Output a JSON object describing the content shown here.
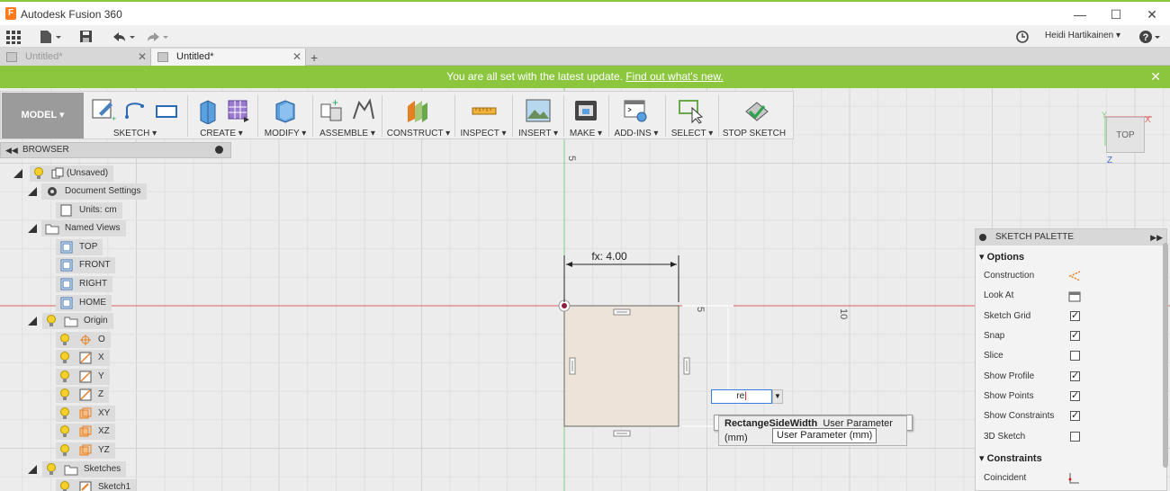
{
  "window": {
    "title": "Autodesk Fusion 360"
  },
  "user": {
    "name": "Heidi Hartikainen ▾"
  },
  "tabs": [
    {
      "label": "Untitled*"
    },
    {
      "label": "Untitled*"
    }
  ],
  "banner": {
    "text": "You are all set with the latest update.",
    "link": "Find out what's new."
  },
  "ribbon": {
    "workspace": "MODEL ▾",
    "groups": [
      "SKETCH ▾",
      "CREATE ▾",
      "MODIFY ▾",
      "ASSEMBLE ▾",
      "CONSTRUCT ▾",
      "INSPECT ▾",
      "INSERT ▾",
      "MAKE ▾",
      "ADD-INS ▾",
      "SELECT ▾",
      "STOP SKETCH"
    ]
  },
  "browser": {
    "title": "BROWSER",
    "nodes": {
      "root": "(Unsaved)",
      "doc_settings": "Document Settings",
      "units": "Units: cm",
      "named_views": "Named Views",
      "top": "TOP",
      "front": "FRONT",
      "right": "RIGHT",
      "home": "HOME",
      "origin": "Origin",
      "o": "O",
      "x": "X",
      "y": "Y",
      "z": "Z",
      "xy": "XY",
      "xz": "XZ",
      "yz": "YZ",
      "sketches": "Sketches",
      "sketch1": "Sketch1"
    }
  },
  "viewcube": {
    "face": "TOP",
    "x_axis": "X",
    "y_axis": "Y",
    "z_axis": "Z"
  },
  "canvas": {
    "dimension_label": "fx: 4.00",
    "tick_top": "5",
    "tick_right_near": "5",
    "tick_right_far": "10",
    "input_value": "re",
    "suggestion_name": "RectangeSideWidth",
    "suggestion_type": "User Parameter (mm)",
    "tooltip": "User Parameter (mm)"
  },
  "palette": {
    "title": "SKETCH PALETTE",
    "options_header": "Options",
    "constraints_header": "Constraints",
    "options": [
      {
        "label": "Construction",
        "control": "construction-icon"
      },
      {
        "label": "Look At",
        "control": "look-at-icon"
      },
      {
        "label": "Sketch Grid",
        "checked": true
      },
      {
        "label": "Snap",
        "checked": true
      },
      {
        "label": "Slice",
        "checked": false
      },
      {
        "label": "Show Profile",
        "checked": true
      },
      {
        "label": "Show Points",
        "checked": true
      },
      {
        "label": "Show Constraints",
        "checked": true
      },
      {
        "label": "3D Sketch",
        "checked": false
      }
    ],
    "constraints": [
      {
        "label": "Coincident"
      }
    ]
  },
  "colors": {
    "banner": "#8cc63f",
    "x_axis": "#e06060",
    "y_axis": "#7ed07e",
    "sketch_fill": "#ede3d8"
  }
}
